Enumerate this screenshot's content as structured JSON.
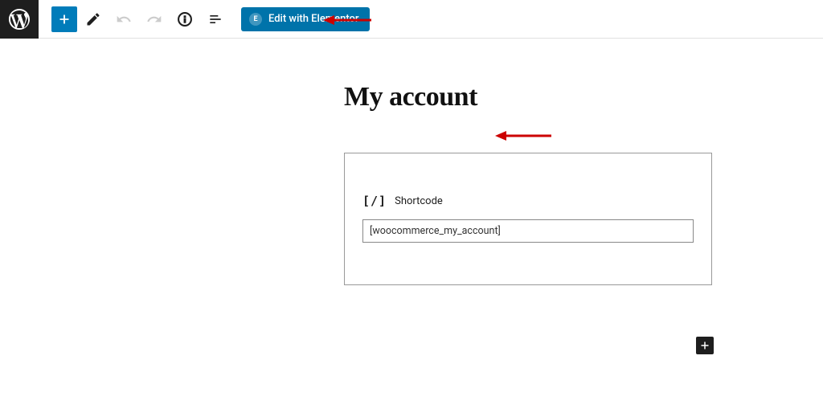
{
  "toolbar": {
    "elementor_button_label": "Edit with Elementor"
  },
  "page": {
    "title": "My account"
  },
  "block": {
    "label": "Shortcode",
    "shortcode_value": "[woocommerce_my_account]"
  }
}
